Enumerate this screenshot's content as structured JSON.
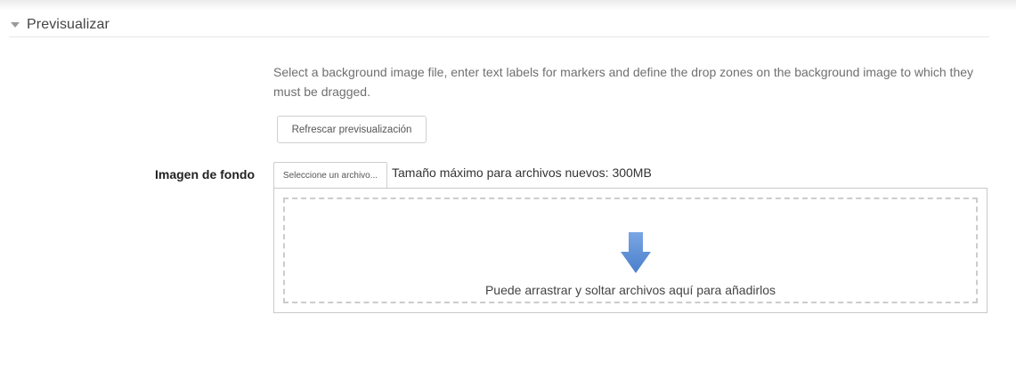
{
  "section": {
    "title": "Previsualizar"
  },
  "description": "Select a background image file, enter text labels for markers and define the drop zones on the background image to which they must be dragged.",
  "refresh_button": {
    "label": "Refrescar previsualización"
  },
  "background_image": {
    "label": "Imagen de fondo",
    "choose_file_label": "Seleccione un archivo...",
    "max_size_text": "Tamaño máximo para archivos nuevos: 300MB",
    "drop_zone_text": "Puede arrastrar y soltar archivos aquí para añadirlos",
    "drop_icon": "download-arrow-icon"
  },
  "colors": {
    "arrow": "#5b8fd6",
    "dash": "#cccccc"
  }
}
